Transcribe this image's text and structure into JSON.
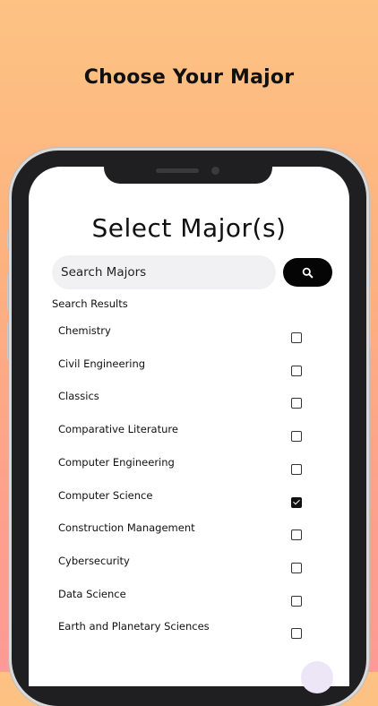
{
  "headline": "Choose Your Major",
  "screen": {
    "title": "Select Major(s)",
    "search": {
      "placeholder": "Search Majors"
    },
    "results_label": "Search Results",
    "items": [
      {
        "label": "Chemistry",
        "checked": false
      },
      {
        "label": "Civil Engineering",
        "checked": false
      },
      {
        "label": "Classics",
        "checked": false
      },
      {
        "label": "Comparative Literature",
        "checked": false
      },
      {
        "label": "Computer Engineering",
        "checked": false
      },
      {
        "label": "Computer Science",
        "checked": true
      },
      {
        "label": "Construction Management",
        "checked": false
      },
      {
        "label": "Cybersecurity",
        "checked": false
      },
      {
        "label": "Data Science",
        "checked": false
      },
      {
        "label": "Earth and Planetary Sciences",
        "checked": false
      }
    ]
  },
  "colors": {
    "background_top": "#fdc383",
    "background_bottom": "#fd9a95",
    "accent": "#050505",
    "search_field": "#f1f1f3"
  },
  "icons": {
    "search_button": "search-icon",
    "checkbox_checked": "check-icon"
  }
}
